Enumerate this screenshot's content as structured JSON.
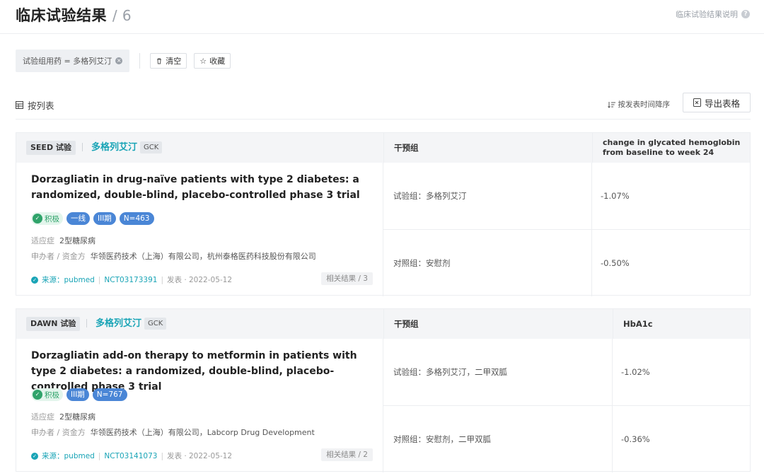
{
  "header": {
    "title": "临床试验结果",
    "count_sep": "/",
    "count": "6",
    "help_label": "临床试验结果说明"
  },
  "filters": {
    "chip_label": "试验组用药 = 多格列艾汀",
    "clear_label": "清空",
    "favorite_label": "收藏"
  },
  "view": {
    "list_label": "按列表",
    "sort_label": "按发表时间降序",
    "export_label": "导出表格"
  },
  "trials": [
    {
      "trial_tag": "SEED 试验",
      "drug": "多格列艾汀",
      "gene": "GCK",
      "col_intervention": "干预组",
      "col_outcome": "change in glycated hemoglobin from baseline to week 24",
      "title": "Dorzagliatin in drug-naïve patients with type 2 diabetes: a randomized, double-blind, placebo-controlled phase 3 trial",
      "badge_positive": "积极",
      "badges": [
        "一线",
        "III期",
        "N=463"
      ],
      "indication_label": "适应症",
      "indication": "2型糖尿病",
      "sponsor_label": "申办者 / 资金方",
      "sponsor": "华领医药技术（上海）有限公司，杭州泰格医药科技股份有限公司",
      "source": "来源：pubmed",
      "nct": "NCT03173391",
      "published": "发表 · 2022-05-12",
      "related": "相关结果 / 3",
      "arms": [
        {
          "group": "试验组：多格列艾汀",
          "value": "-1.07%"
        },
        {
          "group": "对照组：安慰剂",
          "value": "-0.50%"
        }
      ]
    },
    {
      "trial_tag": "DAWN 试验",
      "drug": "多格列艾汀",
      "gene": "GCK",
      "col_intervention": "干预组",
      "col_outcome": "HbA1c",
      "title": "Dorzagliatin add-on therapy to metformin in patients with type 2 diabetes: a randomized, double-blind, placebo-controlled phase 3 trial",
      "badge_positive": "积极",
      "badges": [
        "III期",
        "N=767"
      ],
      "indication_label": "适应症",
      "indication": "2型糖尿病",
      "sponsor_label": "申办者 / 资金方",
      "sponsor": "华领医药技术（上海）有限公司，Labcorp Drug Development",
      "source": "来源：pubmed",
      "nct": "NCT03141073",
      "published": "发表 · 2022-05-12",
      "related": "相关结果 / 2",
      "arms": [
        {
          "group": "试验组：多格列艾汀，二甲双胍",
          "value": "-1.02%"
        },
        {
          "group": "对照组：安慰剂，二甲双胍",
          "value": "-0.36%"
        }
      ]
    }
  ]
}
